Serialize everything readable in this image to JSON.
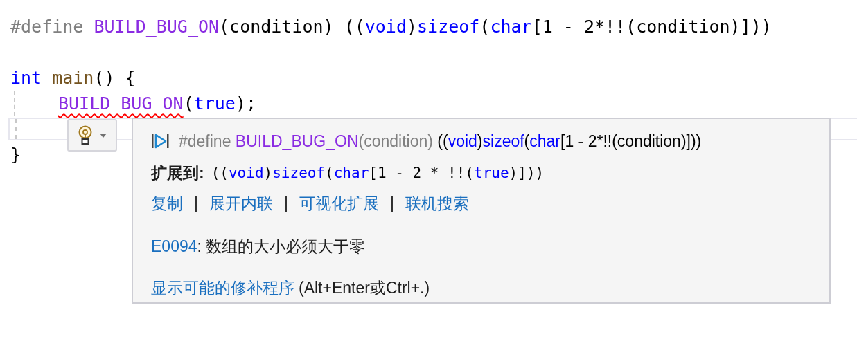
{
  "editor": {
    "lines": [
      {
        "kind": "code",
        "tokens": [
          {
            "kind": "pre",
            "text": "#define "
          },
          {
            "kind": "macro",
            "text": "BUILD_BUG_ON"
          },
          {
            "kind": "text",
            "text": "(condition) (("
          },
          {
            "kind": "kw",
            "text": "void"
          },
          {
            "kind": "text",
            "text": ")"
          },
          {
            "kind": "kw",
            "text": "sizeof"
          },
          {
            "kind": "text",
            "text": "("
          },
          {
            "kind": "kw",
            "text": "char"
          },
          {
            "kind": "text",
            "text": "[1 - 2*!!(condition)]))"
          }
        ]
      },
      {
        "kind": "blank"
      },
      {
        "kind": "code",
        "tokens": [
          {
            "kind": "kw",
            "text": "int "
          },
          {
            "kind": "fn",
            "text": "main"
          },
          {
            "kind": "text",
            "text": "() {"
          }
        ]
      },
      {
        "kind": "code",
        "indent": true,
        "tokens": [
          {
            "kind": "macro",
            "text": "BUILD_BUG_ON",
            "error": true
          },
          {
            "kind": "text",
            "text": "("
          },
          {
            "kind": "kw",
            "text": "true"
          },
          {
            "kind": "text",
            "text": ");"
          }
        ]
      },
      {
        "kind": "blank",
        "indent": true,
        "current": true
      },
      {
        "kind": "code",
        "tokens": [
          {
            "kind": "text",
            "text": "}"
          }
        ]
      }
    ]
  },
  "quick_info": {
    "definition": [
      {
        "kind": "pre",
        "text": "#define "
      },
      {
        "kind": "macro",
        "text": "BUILD_BUG_ON"
      },
      {
        "kind": "pre",
        "text": "(condition)"
      },
      {
        "kind": "text",
        "text": " (("
      },
      {
        "kind": "kw",
        "text": "void"
      },
      {
        "kind": "text",
        "text": ")"
      },
      {
        "kind": "kw",
        "text": "sizeof"
      },
      {
        "kind": "text",
        "text": "("
      },
      {
        "kind": "kw",
        "text": "char"
      },
      {
        "kind": "text",
        "text": "[1 - 2*!!(condition)]))"
      }
    ],
    "expansion_label": "扩展到:",
    "expansion": [
      {
        "kind": "text",
        "text": "(("
      },
      {
        "kind": "kw",
        "text": "void"
      },
      {
        "kind": "text",
        "text": ")"
      },
      {
        "kind": "kw",
        "text": "sizeof"
      },
      {
        "kind": "text",
        "text": "("
      },
      {
        "kind": "kw",
        "text": "char"
      },
      {
        "kind": "text",
        "text": "[1 - 2 * !!("
      },
      {
        "kind": "kw",
        "text": "true"
      },
      {
        "kind": "text",
        "text": ")]))"
      }
    ],
    "actions": [
      {
        "kind": "link",
        "text": "复制"
      },
      {
        "kind": "separator",
        "text": "|"
      },
      {
        "kind": "link",
        "text": "展开内联"
      },
      {
        "kind": "separator",
        "text": "|"
      },
      {
        "kind": "link",
        "text": "可视化扩展"
      },
      {
        "kind": "separator",
        "text": "|"
      },
      {
        "kind": "link",
        "text": "联机搜索"
      }
    ],
    "error": {
      "code": "E0094",
      "message": ": 数组的大小必须大于零"
    },
    "fix": {
      "link": "显示可能的修补程序",
      "shortcut": "(Alt+Enter或Ctrl+.)"
    }
  }
}
